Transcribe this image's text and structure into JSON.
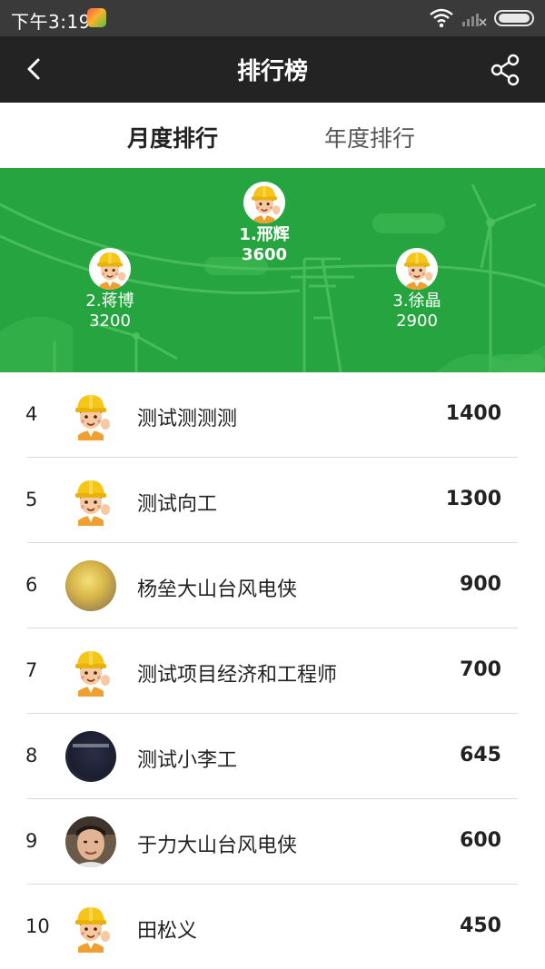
{
  "status_bar": {
    "time": "下午3:19",
    "icons": [
      "app-icon",
      "wifi-icon",
      "signal-icon",
      "battery-icon"
    ]
  },
  "nav": {
    "title": "排行榜",
    "back_icon": "chevron-left-icon",
    "share_icon": "share-icon"
  },
  "tabs": [
    {
      "label": "月度排行",
      "active": true
    },
    {
      "label": "年度排行",
      "active": false
    }
  ],
  "podium": [
    {
      "label": "1.邢辉",
      "score": "3600"
    },
    {
      "label": "2.蒋博",
      "score": "3200"
    },
    {
      "label": "3.徐晶",
      "score": "2900"
    }
  ],
  "list": [
    {
      "rank": "4",
      "name": "测试测测测",
      "score": "1400",
      "avatar": "worker-avatar"
    },
    {
      "rank": "5",
      "name": "测试向工",
      "score": "1300",
      "avatar": "worker-avatar"
    },
    {
      "rank": "6",
      "name": "杨垒大山台风电侠",
      "score": "900",
      "avatar": "photo-avatar"
    },
    {
      "rank": "7",
      "name": "测试项目经济和工程师",
      "score": "700",
      "avatar": "worker-avatar"
    },
    {
      "rank": "8",
      "name": "测试小李工",
      "score": "645",
      "avatar": "photo-avatar"
    },
    {
      "rank": "9",
      "name": "于力大山台风电侠",
      "score": "600",
      "avatar": "photo-avatar"
    },
    {
      "rank": "10",
      "name": "田松义",
      "score": "450",
      "avatar": "worker-avatar"
    }
  ],
  "colors": {
    "status_bar": "#3a3a3a",
    "nav_bar": "#232323",
    "banner_green": "#26a440",
    "helmet_yellow": "#f5c518"
  }
}
